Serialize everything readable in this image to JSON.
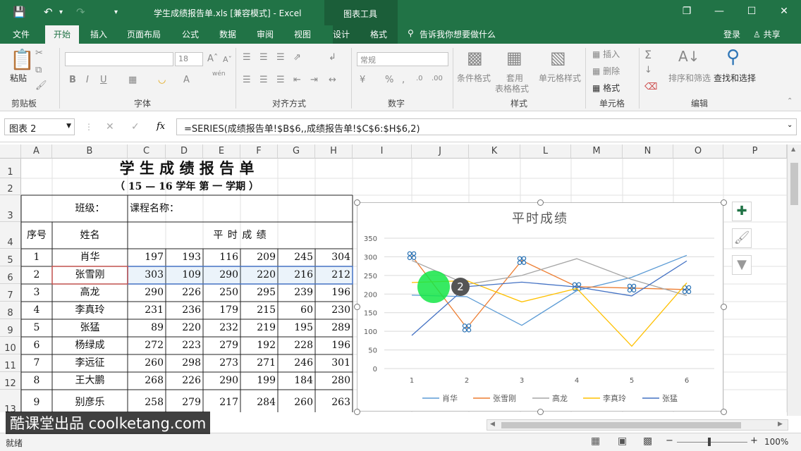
{
  "window": {
    "title": "学生成绩报告单.xls  [兼容模式] - Excel",
    "context_tab": "图表工具"
  },
  "menu": {
    "tabs": [
      "文件",
      "开始",
      "插入",
      "页面布局",
      "公式",
      "数据",
      "审阅",
      "视图",
      "设计",
      "格式"
    ],
    "tell_me": "告诉我你想要做什么",
    "login": "登录",
    "share": "共享"
  },
  "ribbon": {
    "paste": "粘贴",
    "clipboard": "剪贴板",
    "font_box": "",
    "font_size": "18",
    "font_group": "字体",
    "align_group": "对齐方式",
    "number_format": "常规",
    "number_group": "数字",
    "cond_format": "条件格式",
    "table_format_1": "套用",
    "table_format_2": "表格格式",
    "cell_style": "单元格样式",
    "style_group": "样式",
    "insert": "插入",
    "delete": "删除",
    "format": "格式",
    "cells_group": "单元格",
    "sort_filter": "排序和筛选",
    "find_select": "查找和选择",
    "edit_group": "编辑",
    "wen": "wén"
  },
  "formula_bar": {
    "name_box": "图表 2",
    "fx": "fx",
    "formula": "=SERIES(成绩报告单!$B$6,,成绩报告单!$C$6:$H$6,2)"
  },
  "columns": [
    "A",
    "B",
    "C",
    "D",
    "E",
    "F",
    "G",
    "H",
    "I",
    "J",
    "K",
    "L",
    "M",
    "N",
    "O",
    "P"
  ],
  "rows": [
    "1",
    "2",
    "3",
    "4",
    "5",
    "6",
    "7",
    "8",
    "9",
    "10",
    "11",
    "12",
    "13"
  ],
  "sheet": {
    "title": "学 生 成 绩 报 告 单",
    "subtitle": "（ 15 — 16   学年 第 一 学期 ）",
    "class_label": "班级：",
    "course_label": "课程名称：",
    "h_no": "序号",
    "h_name": "姓名",
    "h_score": "平 时 成 绩",
    "students": [
      {
        "no": "1",
        "name": "肖华",
        "s": [
          "197",
          "193",
          "116",
          "209",
          "245",
          "304"
        ]
      },
      {
        "no": "2",
        "name": "张雪刚",
        "s": [
          "303",
          "109",
          "290",
          "220",
          "216",
          "212"
        ]
      },
      {
        "no": "3",
        "name": "高龙",
        "s": [
          "290",
          "226",
          "250",
          "295",
          "239",
          "196"
        ]
      },
      {
        "no": "4",
        "name": "李真玲",
        "s": [
          "231",
          "236",
          "179",
          "215",
          "60",
          "230"
        ]
      },
      {
        "no": "5",
        "name": "张猛",
        "s": [
          "89",
          "220",
          "232",
          "219",
          "195",
          "289"
        ]
      },
      {
        "no": "6",
        "name": "杨绿成",
        "s": [
          "272",
          "223",
          "279",
          "192",
          "228",
          "196"
        ]
      },
      {
        "no": "7",
        "name": "李远征",
        "s": [
          "260",
          "298",
          "273",
          "271",
          "246",
          "301"
        ]
      },
      {
        "no": "8",
        "name": "王大鹏",
        "s": [
          "268",
          "226",
          "290",
          "199",
          "184",
          "280"
        ]
      },
      {
        "no": "9",
        "name": "别彦乐",
        "s": [
          "258",
          "279",
          "217",
          "284",
          "260",
          "263"
        ]
      }
    ]
  },
  "chart_data": {
    "type": "line",
    "title": "平时成绩",
    "categories": [
      "1",
      "2",
      "3",
      "4",
      "5",
      "6"
    ],
    "ylim": [
      0,
      350
    ],
    "yticks": [
      "0",
      "50",
      "100",
      "150",
      "200",
      "250",
      "300",
      "350"
    ],
    "grid": true,
    "legend": "bottom",
    "series": [
      {
        "name": "肖华",
        "color": "#5b9bd5",
        "values": [
          197,
          193,
          116,
          209,
          245,
          304
        ]
      },
      {
        "name": "张雪刚",
        "color": "#ed7d31",
        "values": [
          303,
          109,
          290,
          220,
          216,
          212
        ]
      },
      {
        "name": "高龙",
        "color": "#a5a5a5",
        "values": [
          290,
          226,
          250,
          295,
          239,
          196
        ]
      },
      {
        "name": "李真玲",
        "color": "#ffc000",
        "values": [
          231,
          236,
          179,
          215,
          60,
          230
        ]
      },
      {
        "name": "张猛",
        "color": "#4472c4",
        "values": [
          89,
          220,
          232,
          219,
          195,
          289
        ]
      }
    ],
    "selected_series": "张雪刚"
  },
  "cursor": {
    "step": "2"
  },
  "status": {
    "ready": "就绪",
    "zoom": "100%"
  },
  "watermark": "酷课堂出品 coolketang.com"
}
